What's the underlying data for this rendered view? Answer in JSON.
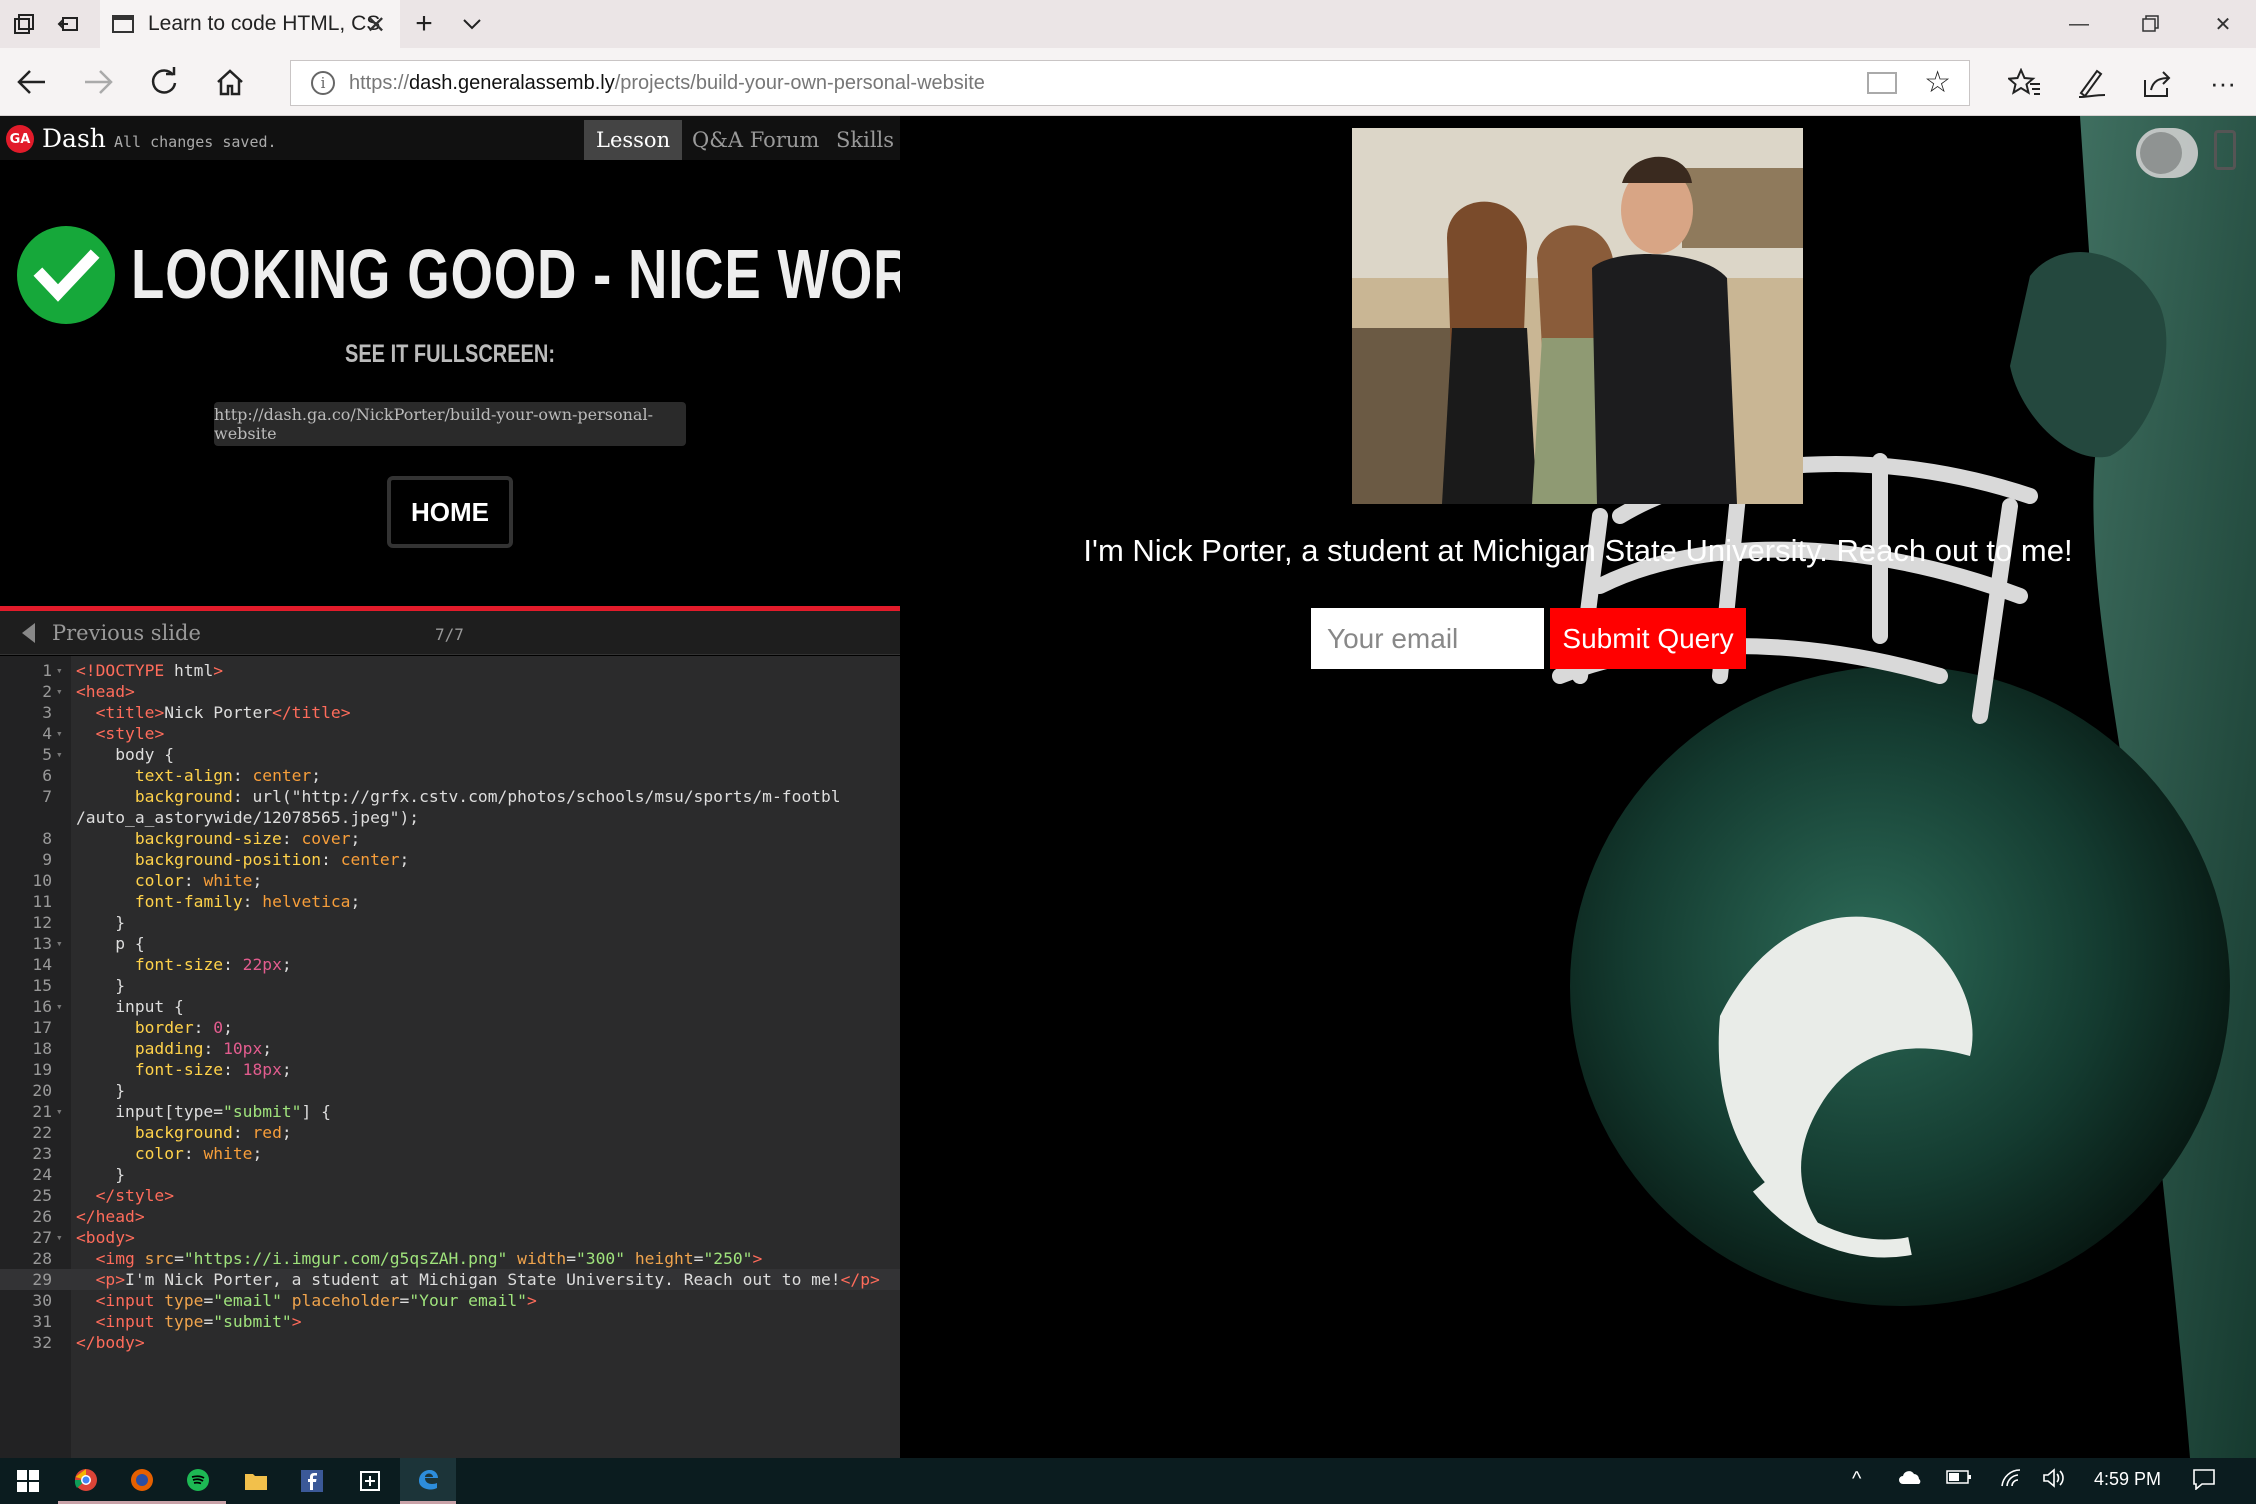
{
  "browser": {
    "tab_title": "Learn to code HTML, CS",
    "url_scheme": "https://",
    "url_host": "dash.generalassemb.ly",
    "url_path": "/projects/build-your-own-personal-website",
    "icons": [
      "tab-list-icon",
      "back-tabs-icon",
      "page-icon",
      "close-icon",
      "plus-icon",
      "chevron-down-icon",
      "back-icon",
      "forward-icon",
      "refresh-icon",
      "home-icon",
      "info-icon",
      "reading-view-icon",
      "star-icon",
      "favorites-icon",
      "pen-icon",
      "share-icon",
      "more-icon",
      "minimize-icon",
      "restore-icon",
      "window-close-icon"
    ]
  },
  "dash": {
    "logo": "GA",
    "name": "Dash",
    "status": "All changes saved.",
    "tabs": [
      "Lesson",
      "Q&A Forum",
      "Skills"
    ],
    "success_title": "LOOKING GOOD - NICE WORK!",
    "see_fullscreen": "SEE IT FULLSCREEN:",
    "fullscreen_url": "http://dash.ga.co/NickPorter/build-your-own-personal-website",
    "home_label": "HOME",
    "prev_slide": "Previous slide",
    "slide_count": "7/7",
    "colors": {
      "accent": "#e21b2a",
      "success": "#16a83a"
    }
  },
  "editor": {
    "current_line": 29,
    "lines": [
      "<!DOCTYPE html>",
      "<head>",
      "  <title>Nick Porter</title>",
      "  <style>",
      "    body {",
      "      text-align: center;",
      "      background: url(\"http://grfx.cstv.com/photos/schools/msu/sports/m-footbl",
      "/auto_a_astorywide/12078565.jpeg\");",
      "      background-size: cover;",
      "      background-position: center;",
      "      color: white;",
      "      font-family: helvetica;",
      "    }",
      "    p {",
      "      font-size: 22px;",
      "    }",
      "    input {",
      "      border: 0;",
      "      padding: 10px;",
      "      font-size: 18px;",
      "    }",
      "    input[type=\"submit\"] {",
      "      background: red;",
      "      color: white;",
      "    }",
      "  </style>",
      "</head>",
      "<body>",
      "  <img src=\"https://i.imgur.com/g5qsZAH.png\" width=\"300\" height=\"250\">",
      "  <p>I'm Nick Porter, a student at Michigan State University. Reach out to me!</p>",
      "  <input type=\"email\" placeholder=\"Your email\">",
      "  <input type=\"submit\">",
      "</body>"
    ],
    "line_numbers": [
      "1",
      "2",
      "3",
      "4",
      "5",
      "6",
      "7",
      "",
      "8",
      "9",
      "10",
      "11",
      "12",
      "13",
      "14",
      "15",
      "16",
      "17",
      "18",
      "19",
      "20",
      "21",
      "22",
      "23",
      "24",
      "25",
      "26",
      "27",
      "28",
      "29",
      "30",
      "31",
      "32"
    ],
    "folds": [
      1,
      2,
      4,
      5,
      13,
      16,
      21,
      27
    ]
  },
  "preview": {
    "intro_text": "I'm Nick Porter, a student at Michigan State University. Reach out to me!",
    "email_placeholder": "Your email",
    "submit_label": "Submit Query"
  },
  "taskbar": {
    "apps": [
      "windows-start-icon",
      "chrome-icon",
      "firefox-icon",
      "spotify-icon",
      "file-explorer-icon",
      "facebook-icon",
      "snip-icon",
      "edge-icon"
    ],
    "time": "4:59 PM"
  }
}
